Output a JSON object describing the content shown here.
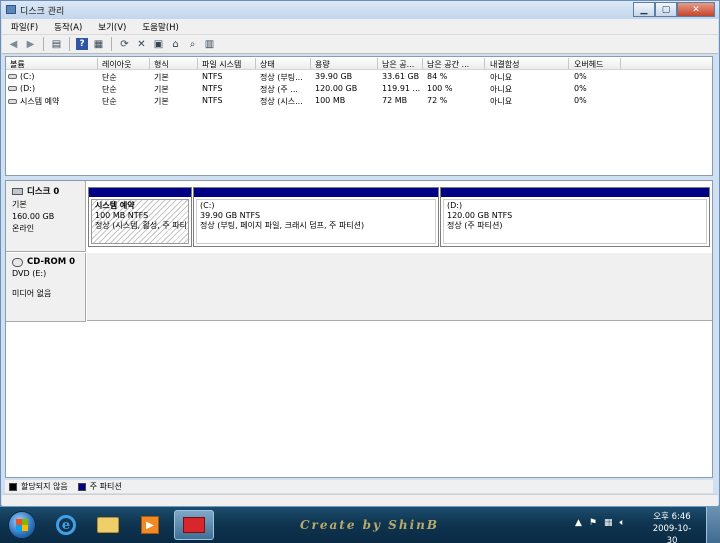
{
  "window": {
    "title": "디스크 관리",
    "controls": {
      "minimize": "▁",
      "maximize": "▢",
      "close": "✕"
    }
  },
  "menu": [
    "파일(F)",
    "동작(A)",
    "보기(V)",
    "도움말(H)"
  ],
  "toolbar": {
    "icons": [
      "back-arrow-icon",
      "forward-arrow-icon",
      "properties-pane-icon",
      "help-icon",
      "console-tree-icon",
      "refresh-icon",
      "delete-icon",
      "properties-icon",
      "open-folder-icon",
      "search-icon",
      "settings-icon"
    ]
  },
  "volume_list": {
    "columns": [
      "볼륨",
      "레이아웃",
      "형식",
      "파일 시스템",
      "상태",
      "용량",
      "남은 공...",
      "남은 공간 ...",
      "내결함성",
      "오버헤드"
    ],
    "rows": [
      [
        "(C:)",
        "단순",
        "기본",
        "NTFS",
        "정상 (부팅...",
        "39.90 GB",
        "33.61 GB",
        "84 %",
        "아니요",
        "0%"
      ],
      [
        "(D:)",
        "단순",
        "기본",
        "NTFS",
        "정상 (주 ...",
        "120.00 GB",
        "119.91 ...",
        "100 %",
        "아니요",
        "0%"
      ],
      [
        "시스템 예약",
        "단순",
        "기본",
        "NTFS",
        "정상 (시스...",
        "100 MB",
        "72 MB",
        "72 %",
        "아니요",
        "0%"
      ]
    ]
  },
  "disks": [
    {
      "title": "디스크 0",
      "type": "기본",
      "size": "160.00 GB",
      "status": "온라인",
      "partitions": [
        {
          "name": "시스템 예약",
          "size": "100 MB NTFS",
          "status": "정상 (시스템, 활성, 주 파티"
        },
        {
          "name": "(C:)",
          "size": "39.90 GB NTFS",
          "status": "정상 (부팅, 페이지 파일, 크래시 덤프, 주 파티션)"
        },
        {
          "name": "(D:)",
          "size": "120.00 GB NTFS",
          "status": "정상 (주 파티션)"
        }
      ]
    },
    {
      "title": "CD-ROM 0",
      "type": "DVD (E:)",
      "media": "미디어 없음"
    }
  ],
  "legend": {
    "unallocated": "할당되지 않음",
    "primary": "주 파티션",
    "colors": {
      "unallocated": "#000000",
      "primary": "#000085"
    }
  },
  "taskbar": {
    "signature": "Create by ShinB",
    "clock_period_time": "오후 6:46",
    "date": "2009-10-30"
  }
}
